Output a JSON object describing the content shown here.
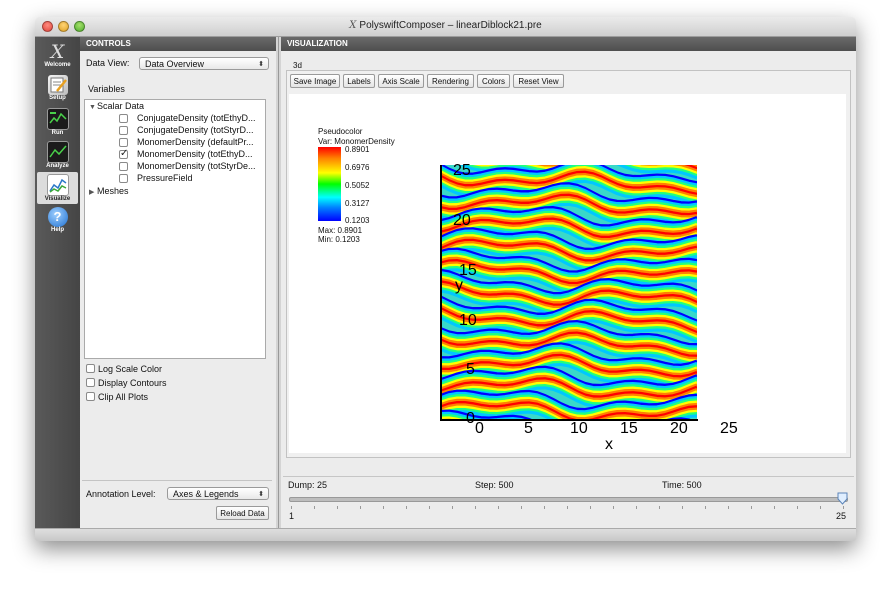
{
  "window": {
    "title": "PolyswiftComposer – linearDiblock21.pre"
  },
  "toolbar": {
    "items": [
      {
        "label": "Welcome",
        "icon": "x-logo-icon"
      },
      {
        "label": "Setup",
        "icon": "setup-icon"
      },
      {
        "label": "Run",
        "icon": "run-icon"
      },
      {
        "label": "Analyze",
        "icon": "analyze-icon"
      },
      {
        "label": "Visualize",
        "icon": "visualize-icon"
      },
      {
        "label": "Help",
        "icon": "help-icon"
      }
    ]
  },
  "controls": {
    "header": "CONTROLS",
    "data_view_label": "Data View:",
    "data_view_value": "Data Overview",
    "variables_label": "Variables",
    "tree": {
      "scalar_data": "Scalar Data",
      "items": [
        {
          "label": "ConjugateDensity (totEthyD...",
          "checked": false
        },
        {
          "label": "ConjugateDensity (totStyrD...",
          "checked": false
        },
        {
          "label": "MonomerDensity (defaultPr...",
          "checked": false
        },
        {
          "label": "MonomerDensity (totEthyD...",
          "checked": true
        },
        {
          "label": "MonomerDensity (totStyrDe...",
          "checked": false
        },
        {
          "label": "PressureField",
          "checked": false
        }
      ],
      "meshes": "Meshes"
    },
    "options": {
      "log_scale": "Log Scale Color",
      "display_contours": "Display Contours",
      "clip_all": "Clip All Plots"
    },
    "annotation_label": "Annotation Level:",
    "annotation_value": "Axes & Legends",
    "reload_button": "Reload Data"
  },
  "visualization": {
    "header": "VISUALIZATION",
    "tab": "3d",
    "buttons": [
      "Save Image",
      "Labels",
      "Axis Scale",
      "Rendering",
      "Colors",
      "Reset View"
    ],
    "legend": {
      "type": "Pseudocolor",
      "var": "Var: MonomerDensity",
      "ticks": [
        "0.8901",
        "0.6976",
        "0.5052",
        "0.3127",
        "0.1203"
      ],
      "max": "Max:  0.8901",
      "min": "Min: 0.1203"
    },
    "axes": {
      "xlabel": "x",
      "ylabel": "y",
      "xticks": [
        "0",
        "5",
        "10",
        "15",
        "20",
        "25"
      ],
      "yticks": [
        "0",
        "5",
        "10",
        "15",
        "20",
        "25"
      ]
    }
  },
  "playback": {
    "dump": "Dump: 25",
    "step": "Step: 500",
    "time": "Time: 500",
    "slider_min": "1",
    "slider_max": "25",
    "slider_value": 25
  },
  "colors": {
    "header_dark": "#4e4e4e",
    "toolbar": "#4a4a4a"
  }
}
